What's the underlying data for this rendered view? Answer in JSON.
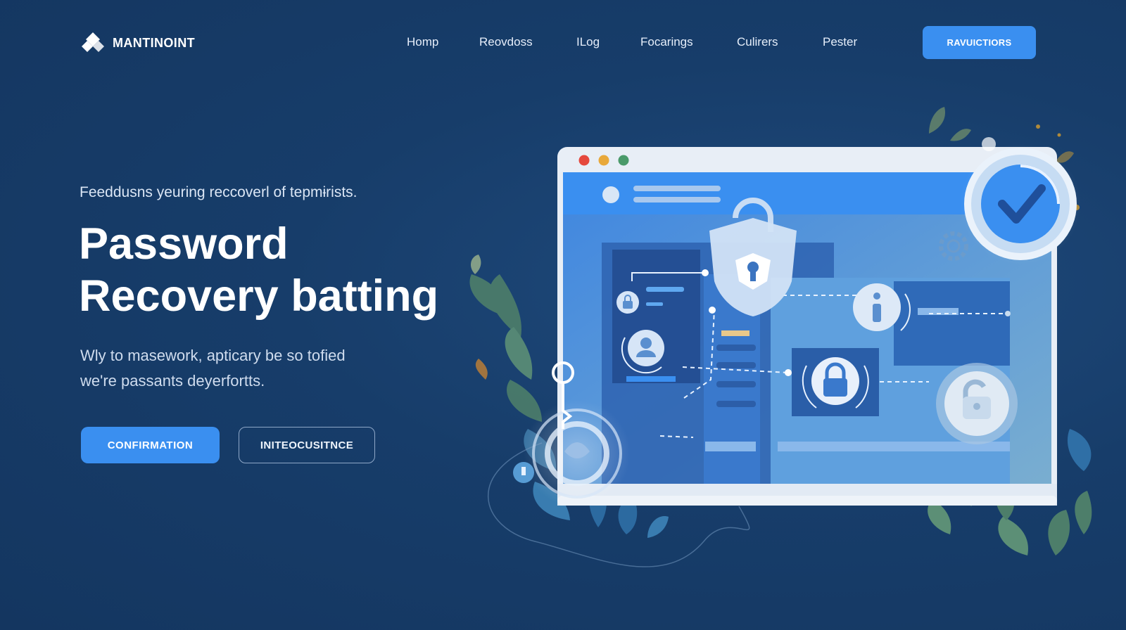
{
  "brand": {
    "name": "MANTINOINT"
  },
  "nav": {
    "items": [
      {
        "label": "Homp"
      },
      {
        "label": "Reovdoss"
      },
      {
        "label": "ILog"
      },
      {
        "label": "Focarings"
      },
      {
        "label": "Culirers"
      },
      {
        "label": "Pester"
      }
    ],
    "cta_label": "RAVUICTIORS"
  },
  "hero": {
    "eyebrow": "Feeddusns yeuring reccoverl of tepmɨrists.",
    "title_line1": "Password",
    "title_line2": "Recovery batting",
    "subtitle_line1": "Wly to masework, apticary be so tofied",
    "subtitle_line2": "we're passants deyerfortts.",
    "primary_button": "CONFIRMATION",
    "secondary_button": "INITEOCUSITNCE"
  },
  "colors": {
    "background": "#173d6a",
    "accent": "#3a8ff0",
    "window_red": "#e5483d",
    "window_yellow": "#e8a83a",
    "window_green": "#4a9a6a",
    "leaf": "#4d7e6a"
  },
  "icons": [
    "logo-icon",
    "shield-lock-icon",
    "info-icon",
    "padlock-icon",
    "user-icon",
    "unlock-icon",
    "checkmark-icon",
    "key-icon",
    "gear-icon"
  ]
}
